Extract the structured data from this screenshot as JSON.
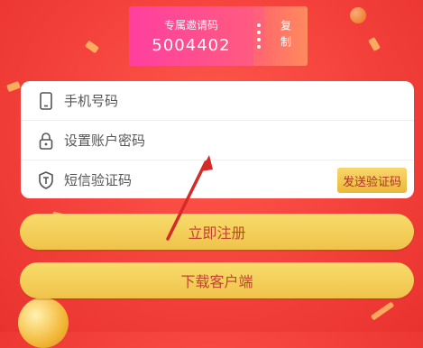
{
  "invite": {
    "title": "专属邀请码",
    "code": "5004402",
    "copy_label": "复制"
  },
  "form": {
    "phone_placeholder": "手机号码",
    "password_placeholder": "设置账户密码",
    "sms_placeholder": "短信验证码",
    "send_code_label": "发送验证码"
  },
  "actions": {
    "register_label": "立即注册",
    "download_label": "下载客户端"
  },
  "colors": {
    "background": "#f4413b",
    "button_gold": "#f0c54c",
    "annotation_arrow": "#d42a2a"
  }
}
